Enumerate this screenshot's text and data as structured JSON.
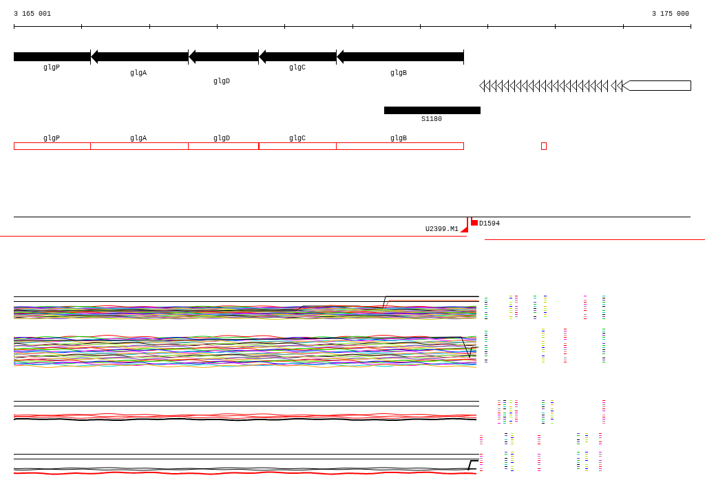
{
  "ruler": {
    "start_label": "3 165 001",
    "end_label": "3 175 000"
  },
  "genes": [
    {
      "label": "glgP",
      "kind": "block"
    },
    {
      "label": "glgA",
      "kind": "arrow"
    },
    {
      "label": "glgD",
      "kind": "arrow"
    },
    {
      "label": "glgC",
      "kind": "arrow"
    },
    {
      "label": "glgB",
      "kind": "arrow"
    }
  ],
  "feature": {
    "label": "S1180"
  },
  "operon": [
    {
      "label": "glgP"
    },
    {
      "label": "glgA"
    },
    {
      "label": "glgD"
    },
    {
      "label": "glgC"
    },
    {
      "label": "glgB"
    }
  ],
  "transcripts": [
    {
      "label": "U2399.M1"
    },
    {
      "label": "D1594"
    }
  ]
}
